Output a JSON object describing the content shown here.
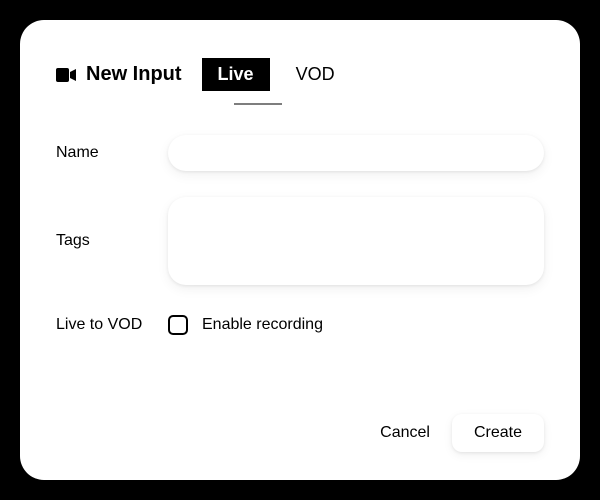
{
  "header": {
    "title": "New Input",
    "tabs": {
      "live": "Live",
      "vod": "VOD",
      "active": "live"
    }
  },
  "form": {
    "name_label": "Name",
    "name_value": "",
    "tags_label": "Tags",
    "tags_value": "",
    "live_to_vod_label": "Live to VOD",
    "enable_recording_label": "Enable recording",
    "enable_recording_checked": false
  },
  "actions": {
    "cancel": "Cancel",
    "create": "Create"
  }
}
